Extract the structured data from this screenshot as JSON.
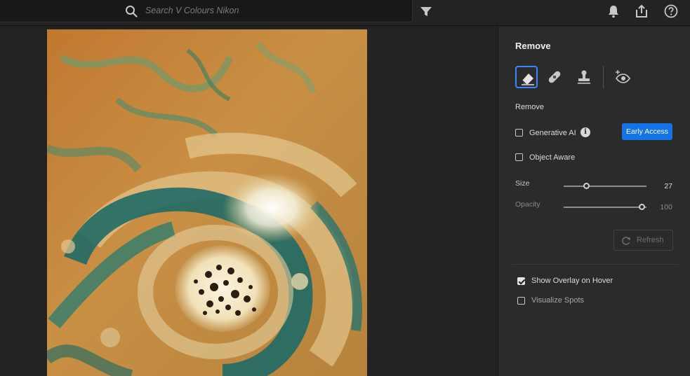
{
  "search": {
    "placeholder": "Search V Colours Nikon"
  },
  "icons": {
    "search": "search-icon",
    "filter": "filter-icon",
    "bell": "bell-icon",
    "share": "share-icon",
    "help": "help-icon",
    "eraser": "eraser-icon",
    "bandage": "bandage-icon",
    "stamp": "stamp-icon",
    "eye_plus": "visualize-eye-icon",
    "refresh": "refresh-icon",
    "info": "info-icon"
  },
  "panel": {
    "title": "Remove",
    "section_label": "Remove",
    "generative_ai": {
      "label": "Generative AI",
      "checked": false,
      "badge": "Early Access"
    },
    "object_aware": {
      "label": "Object Aware",
      "checked": false
    },
    "size": {
      "label": "Size",
      "value": "27",
      "fraction": 0.27
    },
    "opacity": {
      "label": "Opacity",
      "value": "100",
      "fraction": 1.0
    },
    "refresh_label": "Refresh",
    "show_overlay": {
      "label": "Show Overlay on Hover",
      "checked": true
    },
    "visualize_spots": {
      "label": "Visualize Spots",
      "checked": false
    }
  },
  "colors": {
    "accent": "#1473e6",
    "active_tool_border": "#3a86ff",
    "panel_bg": "#2b2b2b"
  }
}
